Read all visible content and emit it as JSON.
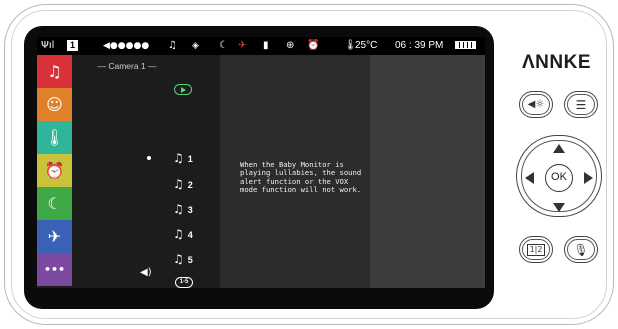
{
  "status_bar": {
    "signal": "Ψıl",
    "camera_number": "1",
    "volume_level": "◀●●●●●",
    "icons": [
      "music-note-icon",
      "vox-mode-icon",
      "night-mode-icon",
      "activity-icon",
      "sd-card-icon",
      "zoom-icon",
      "alarm-icon",
      "temperature-icon"
    ],
    "temperature": "25°C",
    "time": "06 : 39 PM"
  },
  "sidebar": {
    "items": [
      {
        "name": "lullaby",
        "glyph": "♫",
        "color": "#d9323b"
      },
      {
        "name": "baby-face",
        "glyph": "☺",
        "color": "#e0802a"
      },
      {
        "name": "temperature",
        "glyph": "🌡",
        "color": "#2fb59a"
      },
      {
        "name": "alarm",
        "glyph": "⏰",
        "color": "#c9c33c"
      },
      {
        "name": "night-mode",
        "glyph": "☾",
        "color": "#3fa945"
      },
      {
        "name": "activity",
        "glyph": "✈",
        "color": "#3a63b8"
      },
      {
        "name": "more",
        "glyph": "•••",
        "color": "#7b4aa0"
      }
    ]
  },
  "lullaby_list": {
    "camera_label": "—   Camera 1   —",
    "songs": [
      "1",
      "2",
      "3",
      "4",
      "5"
    ],
    "loop_label": "1-5",
    "volume_glyph": "◀)"
  },
  "message": "When the Baby Monitor is playing lullabies, the sound alert function or the VOX mode function will not work.",
  "device": {
    "logo": "ΛNNKE",
    "ok_label": "OK",
    "split_label": "1|2"
  }
}
